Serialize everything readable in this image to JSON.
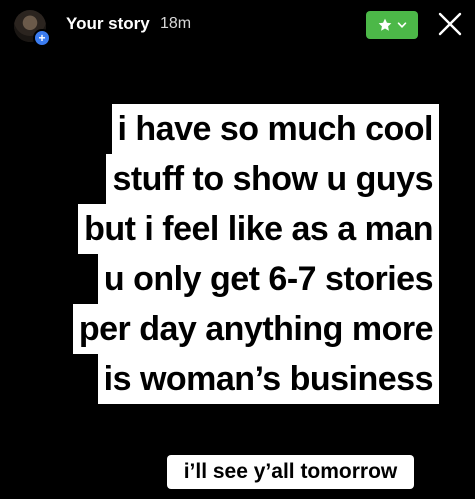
{
  "header": {
    "title": "Your story",
    "time": "18m",
    "add_badge": "+",
    "close_friends_badge_icon": "star-icon",
    "close_icon": "close-icon"
  },
  "story_text": {
    "lines": [
      "i have so much cool",
      "stuff to show u guys",
      "but i feel like as a man",
      "u only get 6-7 stories",
      "per day anything more",
      "is woman’s business"
    ]
  },
  "caption": "i’ll see y’all tomorrow",
  "colors": {
    "background": "#000000",
    "close_friends_green": "#4cb848",
    "add_badge_blue": "#3b7cf0"
  }
}
